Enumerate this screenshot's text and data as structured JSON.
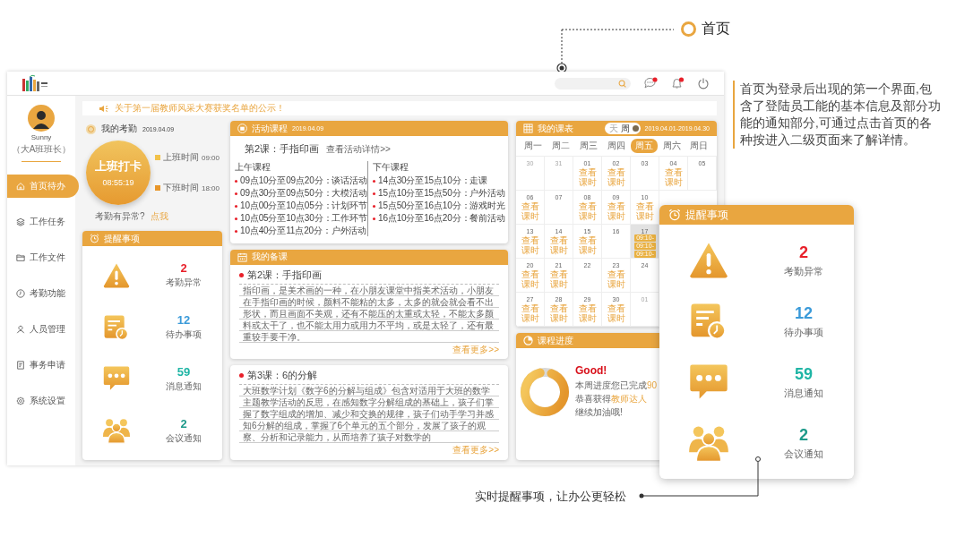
{
  "annotation_top": {
    "title": "首页"
  },
  "description": "首页为登录后出现的第一个界面,包含了登陆员工能的基本信息及部分功能的通知部分,可通过点击首页的各种按进入二级页面来了解详情。",
  "profile": {
    "name": "Sunny",
    "role": "（大A班班长）"
  },
  "sidebar": {
    "items": [
      {
        "label": "首页待办",
        "selected": true
      },
      {
        "label": "工作任务",
        "selected": false
      },
      {
        "label": "工作文件",
        "selected": false
      },
      {
        "label": "考勤功能",
        "selected": false
      },
      {
        "label": "人员管理",
        "selected": false
      },
      {
        "label": "事务申请",
        "selected": false
      },
      {
        "label": "系统设置",
        "selected": false
      }
    ]
  },
  "notice": "关于第一届教师风采大赛获奖名单的公示！",
  "attendance": {
    "title": "我的考勤",
    "date": "2019.04.09",
    "button": {
      "label": "上班打卡",
      "time": "08:55:19"
    },
    "legend": [
      {
        "label": "上班时间",
        "time": "09:00",
        "color": "#f2c24a"
      },
      {
        "label": "下班时间",
        "time": "18:00",
        "color": "#e8962a"
      }
    ],
    "question": "考勤有异常?",
    "link": "点我"
  },
  "reminders": {
    "title": "提醒事项",
    "items": [
      {
        "kind": "warning",
        "count": "2",
        "label": "考勤异常",
        "color": "#e8202a"
      },
      {
        "kind": "todo",
        "count": "12",
        "label": "待办事项",
        "color": "#3a9ad9"
      },
      {
        "kind": "message",
        "count": "59",
        "label": "消息通知",
        "color": "#1fb5a5"
      },
      {
        "kind": "meeting",
        "count": "2",
        "label": "会议通知",
        "color": "#1d9a8a"
      }
    ]
  },
  "activity": {
    "title": "活动课程",
    "date": "2019.04.09",
    "lesson": "第2课：手指印画",
    "link": "查看活动详情>>",
    "sessions": [
      {
        "label": "上午课程",
        "items": [
          "09点10分至09点20分：谈话活动",
          "09点30分至09点50分：大模活动",
          "10点00分至10点05分：计划环节",
          "10点05分至10点30分：工作环节",
          "10点40分至11点20分：户外活动"
        ]
      },
      {
        "label": "下午课程",
        "items": [
          "14点30分至15点10分：走课",
          "15点10分至15点50分：户外活动",
          "15点50分至16点10分：游戏时光",
          "16点10分至16点20分：餐前活动"
        ]
      }
    ]
  },
  "lesson_prep": {
    "title": "我的备课",
    "cards": [
      {
        "title": "第2课：手指印画",
        "text": "指印画，是美术画的一种，在小朋友课堂中指美术活动，小朋友在手指印画的时候，颜料不能粘的太多，太多的就会就会看不出形状，而且画面不美观，还有不能压的太重或太轻，不能太多颜料或太干了，也不能太用力或用力不平均，或是太轻了，还有最重较手要干净。",
        "more": "查看更多>>"
      },
      {
        "title": "第3课：6的分解",
        "text": "大班数学计划《数字6的分解与组成》包含对适用于大班的数学主题教学活动的反思，在感知数字分解组成的基础上，孩子们掌握了数字组成的增加、减少和交换的规律，孩子们动手学习并感知6分解的组成，掌握了6个单元的五个部分，发展了孩子的观察、分析和记录能力，从而培养了孩子对数学的",
        "more": "查看更多>>"
      }
    ]
  },
  "schedule": {
    "title": "我的课表",
    "toggle": [
      {
        "label": "天",
        "selected": false
      },
      {
        "label": "周",
        "selected": true
      }
    ],
    "range": "2019.04.01-2019.04.30",
    "weekdays": [
      {
        "label": "周一",
        "selected": false
      },
      {
        "label": "周二",
        "selected": false
      },
      {
        "label": "周三",
        "selected": false
      },
      {
        "label": "周四",
        "selected": false
      },
      {
        "label": "周五",
        "selected": true
      },
      {
        "label": "周六",
        "selected": false
      },
      {
        "label": "周日",
        "selected": false
      }
    ],
    "rows": [
      [
        {
          "day": "30",
          "other_month": true,
          "selected": false
        },
        {
          "day": "31",
          "other_month": true,
          "selected": false
        },
        {
          "day": "01",
          "link": "查看课时",
          "other_month": false,
          "selected": false
        },
        {
          "day": "02",
          "link": "查看课时",
          "other_month": false,
          "selected": false
        },
        {
          "day": "03",
          "other_month": false,
          "selected": false
        },
        {
          "day": "04",
          "link": "查看课时",
          "other_month": false,
          "selected": false
        },
        {
          "day": "05",
          "other_month": false,
          "selected": false
        }
      ],
      [
        {
          "day": "06",
          "link": "查看课时",
          "other_month": false,
          "selected": false
        },
        {
          "day": "07",
          "other_month": false,
          "selected": false
        },
        {
          "day": "08",
          "link": "查看课时",
          "other_month": false,
          "selected": false
        },
        {
          "day": "09",
          "link": "查看课时",
          "other_month": false,
          "selected": false
        },
        {
          "day": "10",
          "link": "查看课时",
          "other_month": false,
          "selected": false
        }
      ],
      [
        {
          "day": "13",
          "link": "查看课时",
          "other_month": false,
          "selected": false
        },
        {
          "day": "14",
          "link": "查看课时",
          "other_month": false,
          "selected": false
        },
        {
          "day": "15",
          "link": "查看课时",
          "other_month": false,
          "selected": false
        },
        {
          "day": "16",
          "other_month": false,
          "selected": false
        },
        {
          "day": "17",
          "other_month": false,
          "selected": true,
          "times": [
            "09:10-",
            "09:10-",
            "09:10-"
          ]
        }
      ],
      [
        {
          "day": "20",
          "link": "查看课时",
          "other_month": false,
          "selected": false
        },
        {
          "day": "21",
          "link": "查看课时",
          "other_month": false,
          "selected": false
        },
        {
          "day": "22",
          "other_month": false,
          "selected": false
        },
        {
          "day": "23",
          "link": "查看课时",
          "other_month": false,
          "selected": false
        },
        {
          "day": "24",
          "other_month": false,
          "selected": false
        }
      ],
      [
        {
          "day": "27",
          "link": "查看课时",
          "other_month": false,
          "selected": false
        },
        {
          "day": "28",
          "link": "查看课时",
          "other_month": false,
          "selected": false
        },
        {
          "day": "29",
          "link": "查看课时",
          "other_month": false,
          "selected": false
        },
        {
          "day": "30",
          "link": "查看课时",
          "other_month": false,
          "selected": false
        },
        {
          "day": "01",
          "other_month": true,
          "selected": false
        }
      ]
    ]
  },
  "progress": {
    "title": "课程进度",
    "level": 0.9,
    "heading": "Good!",
    "lines": [
      [
        {
          "text": "本周进度您已完成",
          "highlight": false
        },
        {
          "text": "90",
          "highlight": true
        }
      ],
      [
        {
          "text": "恭喜获得",
          "highlight": false
        },
        {
          "text": "教师达人",
          "highlight": true
        }
      ],
      [
        {
          "text": "继续加油哦!",
          "highlight": false
        }
      ]
    ]
  },
  "callout_card": {
    "title": "提醒事项",
    "items": [
      {
        "kind": "warning",
        "count": "2",
        "label": "考勤异常",
        "color": "#e8202a"
      },
      {
        "kind": "todo",
        "count": "12",
        "label": "待办事项",
        "color": "#3a9ad9"
      },
      {
        "kind": "message",
        "count": "59",
        "label": "消息通知",
        "color": "#1fb5a5"
      },
      {
        "kind": "meeting",
        "count": "2",
        "label": "会议通知",
        "color": "#1d9a8a"
      }
    ]
  },
  "caption": "实时提醒事项，让办公更轻松"
}
